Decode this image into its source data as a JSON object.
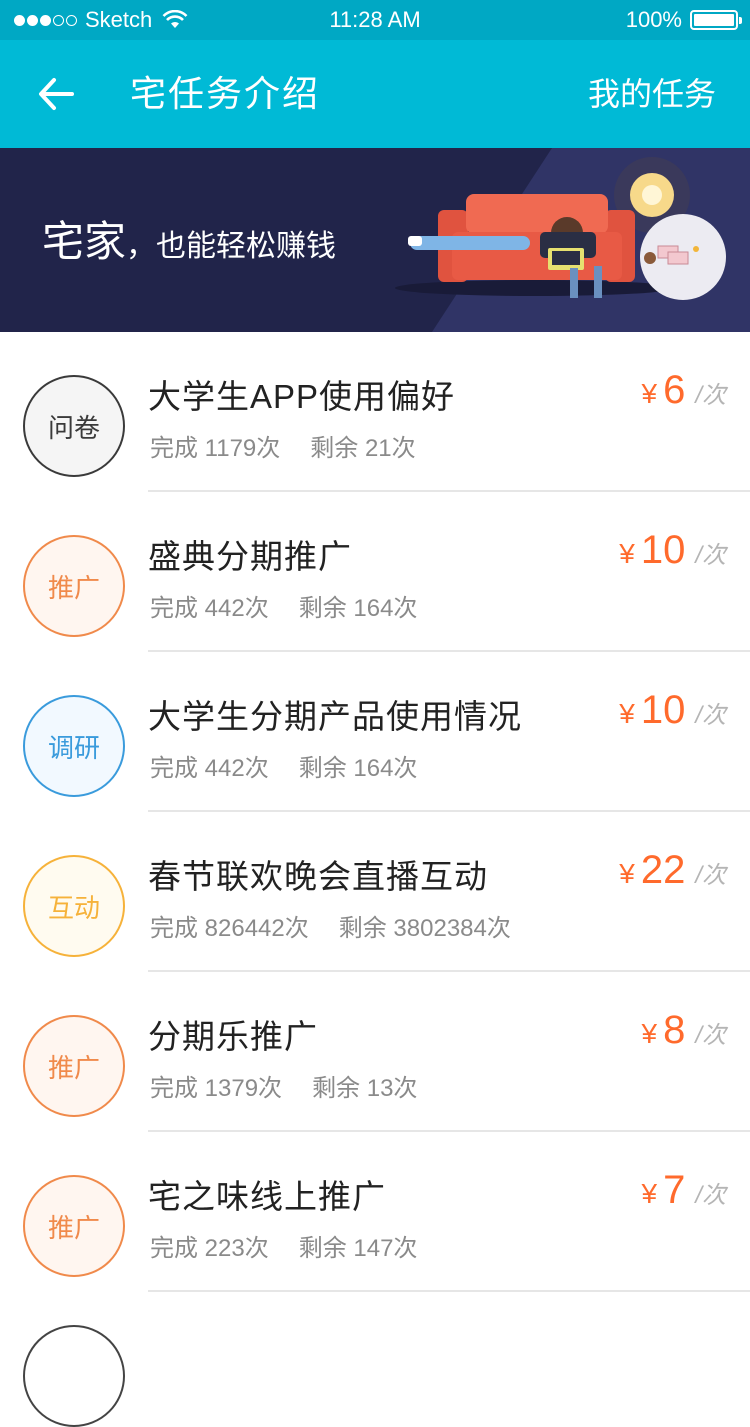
{
  "status_bar": {
    "carrier": "Sketch",
    "time": "11:28 AM",
    "battery": "100%",
    "signal_bars_filled": 3,
    "signal_bars_total": 5
  },
  "nav": {
    "title": "宅任务介绍",
    "action": "我的任务"
  },
  "banner": {
    "headline_big": "宅家",
    "headline_small": "，也能轻松赚钱"
  },
  "tasks": [
    {
      "badge": "问卷",
      "badge_color": "#3a3a3a",
      "badge_bg": "#f5f5f5",
      "title": "大学生APP使用偏好",
      "completed": "完成 1179次",
      "remaining": "剩余 21次",
      "currency": "¥",
      "price": "6",
      "unit": "/次"
    },
    {
      "badge": "推广",
      "badge_color": "#f08a4b",
      "badge_bg": "#fff6f0",
      "title": "盛典分期推广",
      "completed": "完成 442次",
      "remaining": "剩余 164次",
      "currency": "¥",
      "price": "10",
      "unit": "/次"
    },
    {
      "badge": "调研",
      "badge_color": "#3a9bdc",
      "badge_bg": "#f2f9ff",
      "title": "大学生分期产品使用情况",
      "completed": "完成 442次",
      "remaining": "剩余 164次",
      "currency": "¥",
      "price": "10",
      "unit": "/次"
    },
    {
      "badge": "互动",
      "badge_color": "#f6b23a",
      "badge_bg": "#fffbf0",
      "title": "春节联欢晚会直播互动",
      "completed": "完成 826442次",
      "remaining": "剩余 3802384次",
      "currency": "¥",
      "price": "22",
      "unit": "/次"
    },
    {
      "badge": "推广",
      "badge_color": "#f08a4b",
      "badge_bg": "#fff6f0",
      "title": "分期乐推广",
      "completed": "完成 1379次",
      "remaining": "剩余 13次",
      "currency": "¥",
      "price": "8",
      "unit": "/次"
    },
    {
      "badge": "推广",
      "badge_color": "#f08a4b",
      "badge_bg": "#fff6f0",
      "title": "宅之味线上推广",
      "completed": "完成 223次",
      "remaining": "剩余 147次",
      "currency": "¥",
      "price": "7",
      "unit": "/次"
    }
  ],
  "colors": {
    "status_bar": "#00a8c4",
    "nav_bar": "#00bad6",
    "banner_bg": "#21244a",
    "price": "#ff6a2c"
  }
}
